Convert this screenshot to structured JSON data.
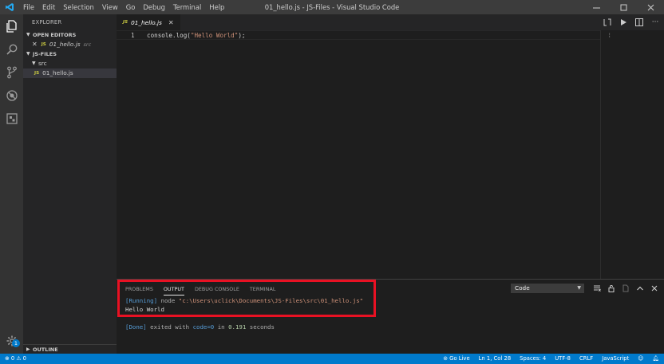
{
  "window": {
    "title": "01_hello.js - JS-Files - Visual Studio Code",
    "menu": [
      "File",
      "Edit",
      "Selection",
      "View",
      "Go",
      "Debug",
      "Terminal",
      "Help"
    ],
    "controls": [
      "minimize",
      "maximize",
      "close"
    ]
  },
  "activity_bar": {
    "items": [
      "explorer",
      "search",
      "source-control",
      "debug",
      "extensions"
    ],
    "settings_badge": "1"
  },
  "sidebar": {
    "title": "EXPLORER",
    "open_editors_label": "OPEN EDITORS",
    "open_editor": {
      "icon": "JS",
      "name": "01_hello.js",
      "folder": "src"
    },
    "project_label": "JS-FILES",
    "folder": "src",
    "file": {
      "icon": "JS",
      "name": "01_hello.js"
    },
    "outline_label": "OUTLINE"
  },
  "editor": {
    "tab": {
      "icon": "JS",
      "name": "01_hello.js"
    },
    "line_number": "1",
    "code_prefix": "console.log(",
    "code_string": "\"Hello World\"",
    "code_suffix": ");"
  },
  "panel": {
    "tabs": [
      "PROBLEMS",
      "OUTPUT",
      "DEBUG CONSOLE",
      "TERMINAL"
    ],
    "active_tab": "OUTPUT",
    "channel": "Code",
    "output": {
      "running_tag": "[Running]",
      "command_prefix": " node ",
      "command_path": "\"c:\\Users\\uclick\\Documents\\JS-Files\\src\\01_hello.js\"",
      "result": "Hello World",
      "done_tag": "[Done]",
      "done_text_1": " exited with ",
      "done_code": "code=0",
      "done_text_2": " in ",
      "done_time": "0.191",
      "done_text_3": " seconds"
    }
  },
  "status_bar": {
    "errors": "0",
    "warnings": "0",
    "go_live": "Go Live",
    "position": "Ln 1, Col 28",
    "spaces": "Spaces: 4",
    "encoding": "UTF-8",
    "eol": "CRLF",
    "language": "JavaScript"
  },
  "colors": {
    "accent": "#007acc",
    "highlight_box": "#e81123",
    "js_icon": "#cbcb41"
  }
}
